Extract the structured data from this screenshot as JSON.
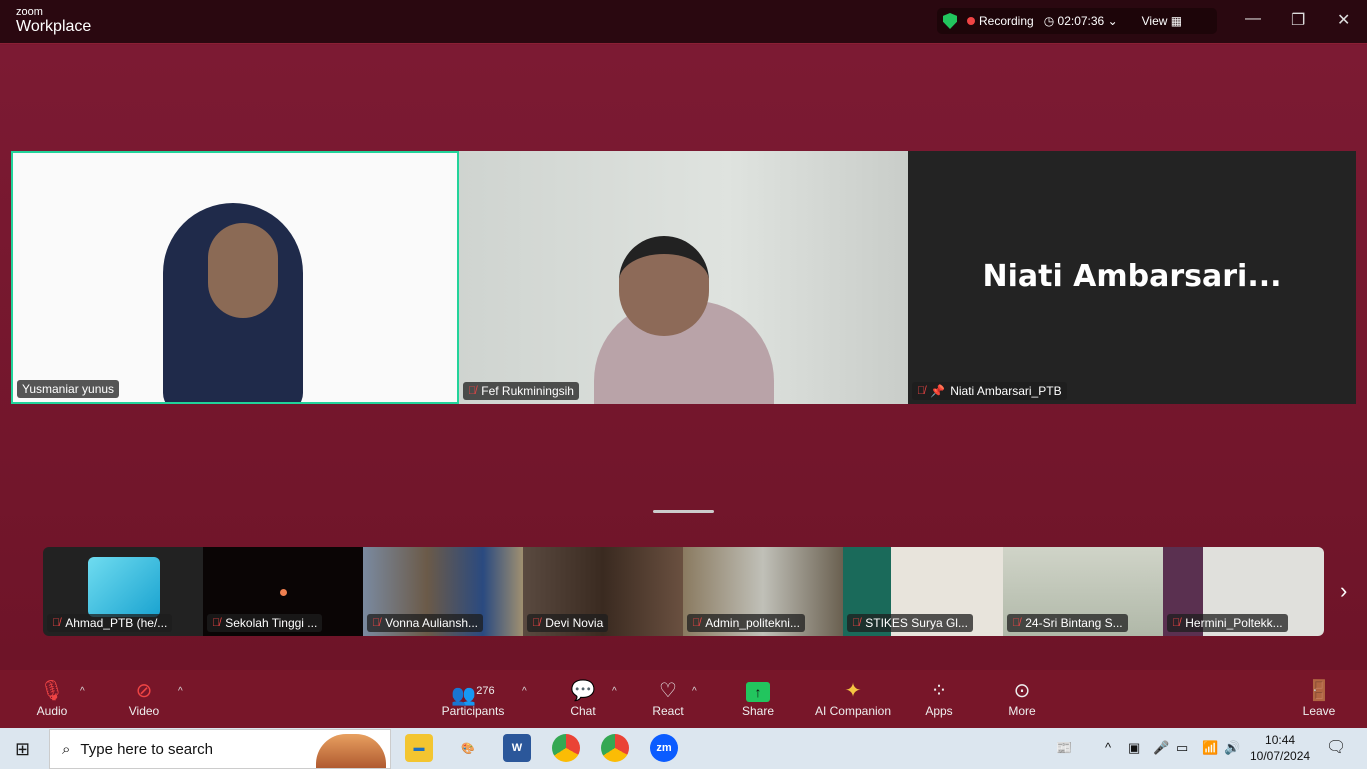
{
  "app": {
    "logo_top": "zoom",
    "logo_bottom": "Workplace"
  },
  "status": {
    "recording": "Recording",
    "timer": "02:07:36",
    "view": "View"
  },
  "speakers": [
    {
      "name": "Yusmaniar yunus",
      "muted": false,
      "active": true
    },
    {
      "name": "Fef Rukminingsih",
      "muted": true
    },
    {
      "name": "Niati Ambarsari_PTB",
      "display": "Niati  Ambarsari...",
      "muted": true,
      "pinned": true
    }
  ],
  "thumbnails": [
    "Ahmad_PTB (he/...",
    "Sekolah Tinggi ...",
    "Vonna Auliansh...",
    "Devi Novia",
    "Admin_politekni...",
    "STIKES Surya Gl...",
    "24-Sri Bintang S...",
    "Hermini_Poltekk..."
  ],
  "toolbar": {
    "audio": "Audio",
    "video": "Video",
    "participants": "Participants",
    "participants_count": "276",
    "chat": "Chat",
    "react": "React",
    "share": "Share",
    "ai": "AI Companion",
    "apps": "Apps",
    "more": "More",
    "leave": "Leave"
  },
  "taskbar": {
    "search_placeholder": "Type here to search",
    "time": "10:44",
    "date": "10/07/2024"
  },
  "colors": {
    "accent": "#7a1830",
    "active_border": "#22d39a",
    "share": "#22c55e"
  }
}
